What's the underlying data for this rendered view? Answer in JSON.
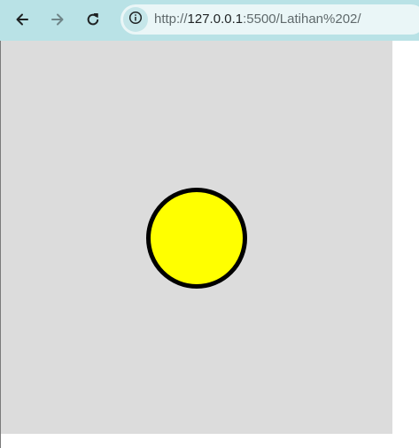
{
  "browser": {
    "back_icon": "arrow-left-icon",
    "forward_icon": "arrow-right-icon",
    "reload_icon": "reload-icon",
    "site_info_icon": "info-icon",
    "url_prefix": "http://",
    "url_host": "127.0.0.1",
    "url_rest": ":5500/Latihan%202/"
  },
  "page": {
    "stage_color": "#dcdcdc",
    "circle_fill": "#ffff00",
    "circle_stroke": "#000000"
  }
}
